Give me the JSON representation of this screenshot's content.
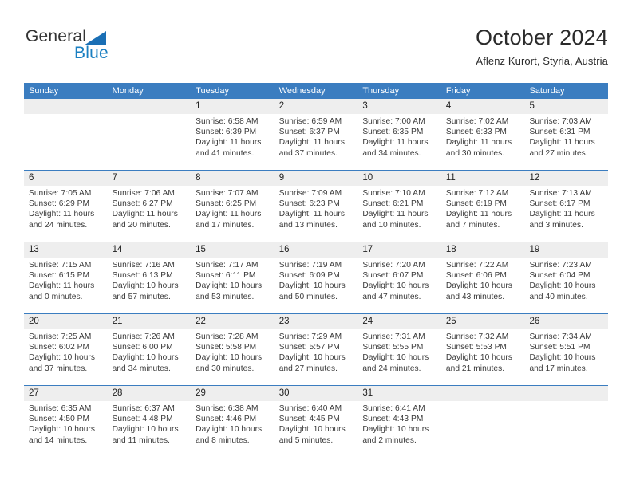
{
  "brand": {
    "name_part1": "General",
    "name_part2": "Blue",
    "triangle_color": "#1a6fb5",
    "text_color": "#333333",
    "blue_color": "#1a7fc1"
  },
  "header": {
    "title": "October 2024",
    "subtitle": "Aflenz Kurort, Styria, Austria"
  },
  "theme": {
    "header_blue": "#3b7dc0",
    "daynum_gray": "#eeeeee",
    "text_dark": "#3a3a3a"
  },
  "calendar": {
    "weekdays": [
      "Sunday",
      "Monday",
      "Tuesday",
      "Wednesday",
      "Thursday",
      "Friday",
      "Saturday"
    ],
    "weeks": [
      [
        {
          "day": "",
          "lines": []
        },
        {
          "day": "",
          "lines": []
        },
        {
          "day": "1",
          "lines": [
            "Sunrise: 6:58 AM",
            "Sunset: 6:39 PM",
            "Daylight: 11 hours",
            "and 41 minutes."
          ]
        },
        {
          "day": "2",
          "lines": [
            "Sunrise: 6:59 AM",
            "Sunset: 6:37 PM",
            "Daylight: 11 hours",
            "and 37 minutes."
          ]
        },
        {
          "day": "3",
          "lines": [
            "Sunrise: 7:00 AM",
            "Sunset: 6:35 PM",
            "Daylight: 11 hours",
            "and 34 minutes."
          ]
        },
        {
          "day": "4",
          "lines": [
            "Sunrise: 7:02 AM",
            "Sunset: 6:33 PM",
            "Daylight: 11 hours",
            "and 30 minutes."
          ]
        },
        {
          "day": "5",
          "lines": [
            "Sunrise: 7:03 AM",
            "Sunset: 6:31 PM",
            "Daylight: 11 hours",
            "and 27 minutes."
          ]
        }
      ],
      [
        {
          "day": "6",
          "lines": [
            "Sunrise: 7:05 AM",
            "Sunset: 6:29 PM",
            "Daylight: 11 hours",
            "and 24 minutes."
          ]
        },
        {
          "day": "7",
          "lines": [
            "Sunrise: 7:06 AM",
            "Sunset: 6:27 PM",
            "Daylight: 11 hours",
            "and 20 minutes."
          ]
        },
        {
          "day": "8",
          "lines": [
            "Sunrise: 7:07 AM",
            "Sunset: 6:25 PM",
            "Daylight: 11 hours",
            "and 17 minutes."
          ]
        },
        {
          "day": "9",
          "lines": [
            "Sunrise: 7:09 AM",
            "Sunset: 6:23 PM",
            "Daylight: 11 hours",
            "and 13 minutes."
          ]
        },
        {
          "day": "10",
          "lines": [
            "Sunrise: 7:10 AM",
            "Sunset: 6:21 PM",
            "Daylight: 11 hours",
            "and 10 minutes."
          ]
        },
        {
          "day": "11",
          "lines": [
            "Sunrise: 7:12 AM",
            "Sunset: 6:19 PM",
            "Daylight: 11 hours",
            "and 7 minutes."
          ]
        },
        {
          "day": "12",
          "lines": [
            "Sunrise: 7:13 AM",
            "Sunset: 6:17 PM",
            "Daylight: 11 hours",
            "and 3 minutes."
          ]
        }
      ],
      [
        {
          "day": "13",
          "lines": [
            "Sunrise: 7:15 AM",
            "Sunset: 6:15 PM",
            "Daylight: 11 hours",
            "and 0 minutes."
          ]
        },
        {
          "day": "14",
          "lines": [
            "Sunrise: 7:16 AM",
            "Sunset: 6:13 PM",
            "Daylight: 10 hours",
            "and 57 minutes."
          ]
        },
        {
          "day": "15",
          "lines": [
            "Sunrise: 7:17 AM",
            "Sunset: 6:11 PM",
            "Daylight: 10 hours",
            "and 53 minutes."
          ]
        },
        {
          "day": "16",
          "lines": [
            "Sunrise: 7:19 AM",
            "Sunset: 6:09 PM",
            "Daylight: 10 hours",
            "and 50 minutes."
          ]
        },
        {
          "day": "17",
          "lines": [
            "Sunrise: 7:20 AM",
            "Sunset: 6:07 PM",
            "Daylight: 10 hours",
            "and 47 minutes."
          ]
        },
        {
          "day": "18",
          "lines": [
            "Sunrise: 7:22 AM",
            "Sunset: 6:06 PM",
            "Daylight: 10 hours",
            "and 43 minutes."
          ]
        },
        {
          "day": "19",
          "lines": [
            "Sunrise: 7:23 AM",
            "Sunset: 6:04 PM",
            "Daylight: 10 hours",
            "and 40 minutes."
          ]
        }
      ],
      [
        {
          "day": "20",
          "lines": [
            "Sunrise: 7:25 AM",
            "Sunset: 6:02 PM",
            "Daylight: 10 hours",
            "and 37 minutes."
          ]
        },
        {
          "day": "21",
          "lines": [
            "Sunrise: 7:26 AM",
            "Sunset: 6:00 PM",
            "Daylight: 10 hours",
            "and 34 minutes."
          ]
        },
        {
          "day": "22",
          "lines": [
            "Sunrise: 7:28 AM",
            "Sunset: 5:58 PM",
            "Daylight: 10 hours",
            "and 30 minutes."
          ]
        },
        {
          "day": "23",
          "lines": [
            "Sunrise: 7:29 AM",
            "Sunset: 5:57 PM",
            "Daylight: 10 hours",
            "and 27 minutes."
          ]
        },
        {
          "day": "24",
          "lines": [
            "Sunrise: 7:31 AM",
            "Sunset: 5:55 PM",
            "Daylight: 10 hours",
            "and 24 minutes."
          ]
        },
        {
          "day": "25",
          "lines": [
            "Sunrise: 7:32 AM",
            "Sunset: 5:53 PM",
            "Daylight: 10 hours",
            "and 21 minutes."
          ]
        },
        {
          "day": "26",
          "lines": [
            "Sunrise: 7:34 AM",
            "Sunset: 5:51 PM",
            "Daylight: 10 hours",
            "and 17 minutes."
          ]
        }
      ],
      [
        {
          "day": "27",
          "lines": [
            "Sunrise: 6:35 AM",
            "Sunset: 4:50 PM",
            "Daylight: 10 hours",
            "and 14 minutes."
          ]
        },
        {
          "day": "28",
          "lines": [
            "Sunrise: 6:37 AM",
            "Sunset: 4:48 PM",
            "Daylight: 10 hours",
            "and 11 minutes."
          ]
        },
        {
          "day": "29",
          "lines": [
            "Sunrise: 6:38 AM",
            "Sunset: 4:46 PM",
            "Daylight: 10 hours",
            "and 8 minutes."
          ]
        },
        {
          "day": "30",
          "lines": [
            "Sunrise: 6:40 AM",
            "Sunset: 4:45 PM",
            "Daylight: 10 hours",
            "and 5 minutes."
          ]
        },
        {
          "day": "31",
          "lines": [
            "Sunrise: 6:41 AM",
            "Sunset: 4:43 PM",
            "Daylight: 10 hours",
            "and 2 minutes."
          ]
        },
        {
          "day": "",
          "lines": []
        },
        {
          "day": "",
          "lines": []
        }
      ]
    ]
  }
}
